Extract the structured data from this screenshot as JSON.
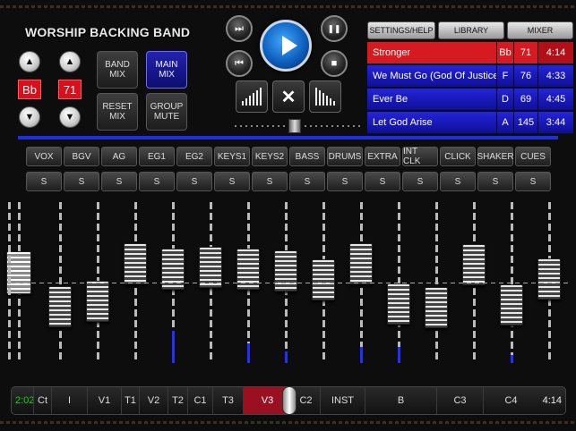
{
  "app": {
    "title": "WORSHIP BACKING BAND"
  },
  "key_control": {
    "value": "Bb",
    "up_icon": "triangle-up-icon",
    "down_icon": "triangle-down-icon"
  },
  "tempo_control": {
    "value": "71"
  },
  "mix_buttons": {
    "band_mix": "BAND\nMIX",
    "main_mix": "MAIN\nMIX",
    "reset_mix": "RESET\nMIX",
    "group_mute": "GROUP\nMUTE"
  },
  "transport": {
    "skip_forward": "⏭",
    "rewind": "⏮",
    "pause": "❚❚",
    "stop": "■",
    "shuffle": "✕"
  },
  "top_tabs": {
    "settings": "SETTINGS/HELP",
    "library": "LIBRARY",
    "mixer": "MIXER"
  },
  "playlist": [
    {
      "name": "Stronger",
      "key": "Bb",
      "tempo": "71",
      "duration": "4:14",
      "selected": true
    },
    {
      "name": "We Must Go (God Of Justice)",
      "key": "F",
      "tempo": "76",
      "duration": "4:33",
      "selected": false
    },
    {
      "name": "Ever Be",
      "key": "D",
      "tempo": "69",
      "duration": "4:45",
      "selected": false
    },
    {
      "name": "Let God Arise",
      "key": "A",
      "tempo": "145",
      "duration": "3:44",
      "selected": false
    }
  ],
  "channels": [
    {
      "label": "VOX",
      "solo": "S",
      "level": 0.3,
      "meter": 0
    },
    {
      "label": "BGV",
      "solo": "S",
      "level": 0.34,
      "meter": 0
    },
    {
      "label": "AG",
      "solo": "S",
      "level": 0.66,
      "meter": 0
    },
    {
      "label": "EG1",
      "solo": "S",
      "level": 0.61,
      "meter": 0.2
    },
    {
      "label": "EG2",
      "solo": "S",
      "level": 0.63,
      "meter": 0
    },
    {
      "label": "KEYS1",
      "solo": "S",
      "level": 0.61,
      "meter": 0.12
    },
    {
      "label": "KEYS2",
      "solo": "S",
      "level": 0.6,
      "meter": 0.07
    },
    {
      "label": "BASS",
      "solo": "S",
      "level": 0.52,
      "meter": 0
    },
    {
      "label": "DRUMS",
      "solo": "S",
      "level": 0.66,
      "meter": 0.1
    },
    {
      "label": "EXTRA",
      "solo": "S",
      "level": 0.32,
      "meter": 0.1
    },
    {
      "label": "INT CLK",
      "solo": "S",
      "level": 0.29,
      "meter": 0
    },
    {
      "label": "CLICK",
      "solo": "S",
      "level": 0.65,
      "meter": 0
    },
    {
      "label": "SHAKER",
      "solo": "S",
      "level": 0.31,
      "meter": 0.05
    },
    {
      "label": "CUES",
      "solo": "S",
      "level": 0.53,
      "meter": 0
    }
  ],
  "master": {
    "level": 0.58
  },
  "timeline": {
    "start_time": "2:02",
    "end_time": "4:14",
    "sections": [
      "Ct",
      "I",
      "V1",
      "T1",
      "V2",
      "T2",
      "C1",
      "T3",
      "V3",
      "C2",
      "INST",
      "B",
      "C3",
      "C4"
    ],
    "current": "V3"
  }
}
